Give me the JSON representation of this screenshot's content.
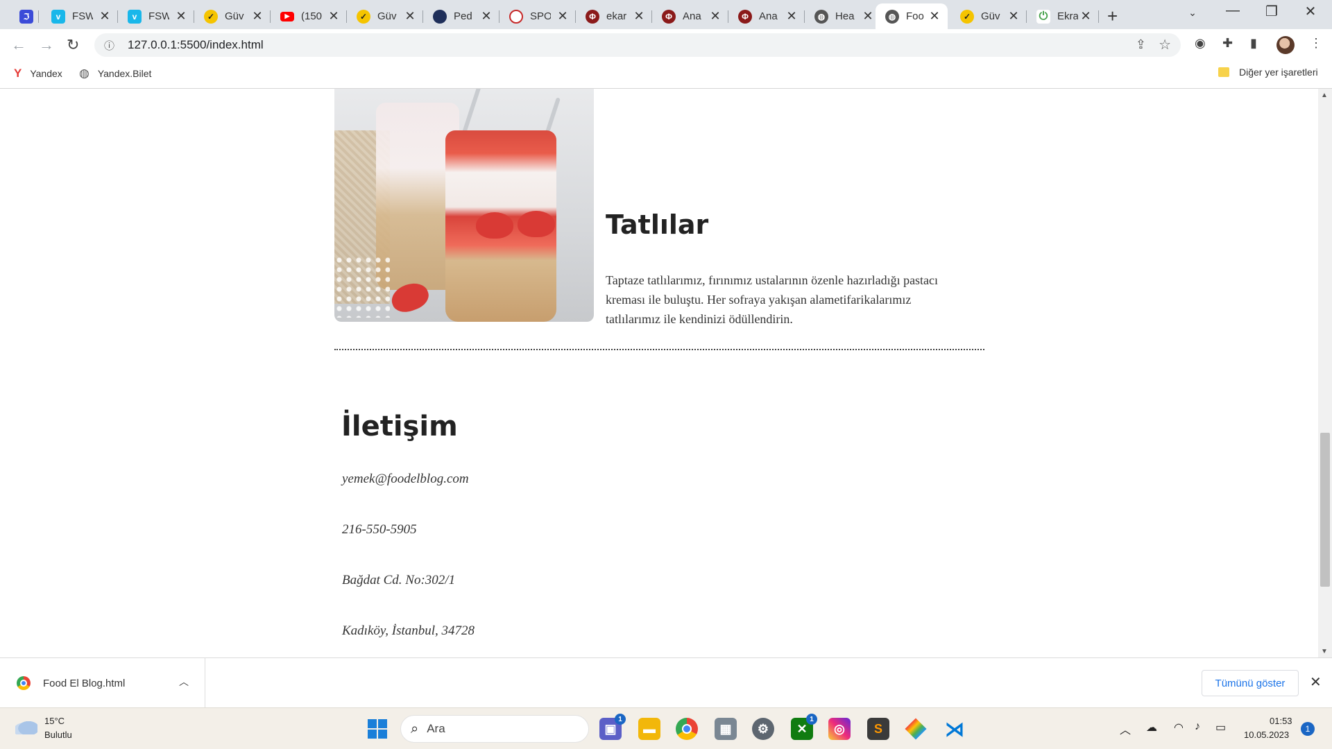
{
  "browser": {
    "tabs": [
      {
        "title": "",
        "icon": "vue-icon",
        "color": "#3b4bd8"
      },
      {
        "title": "FSW",
        "icon": "vimeo-icon",
        "color": "#19b7ea"
      },
      {
        "title": "FSW",
        "icon": "vimeo-icon",
        "color": "#19b7ea"
      },
      {
        "title": "Güv",
        "icon": "check-icon",
        "color": "#f5c400"
      },
      {
        "title": "(150",
        "icon": "youtube-icon",
        "color": "#ff0000"
      },
      {
        "title": "Güv",
        "icon": "check-icon",
        "color": "#f5c400"
      },
      {
        "title": "Ped",
        "icon": "seal-icon",
        "color": "#1f2f5a"
      },
      {
        "title": "SPO",
        "icon": "seal-icon",
        "color": "#c62828"
      },
      {
        "title": "ekar",
        "icon": "phi-icon",
        "color": "#8b1a1a"
      },
      {
        "title": "Ana",
        "icon": "phi-icon",
        "color": "#8b1a1a"
      },
      {
        "title": "Ana",
        "icon": "phi-icon",
        "color": "#8b1a1a"
      },
      {
        "title": "Hea",
        "icon": "globe-icon",
        "color": "#555555"
      },
      {
        "title": "Foo",
        "icon": "globe-icon",
        "color": "#555555",
        "active": true
      },
      {
        "title": "Güv",
        "icon": "check-icon",
        "color": "#f5c400"
      },
      {
        "title": "Ekra",
        "icon": "power-icon",
        "color": "#43a047"
      }
    ],
    "url": "127.0.0.1:5500/index.html",
    "bookmarks": [
      {
        "label": "Yandex",
        "icon": "yandex-icon"
      },
      {
        "label": "Yandex.Bilet",
        "icon": "globe-icon"
      }
    ],
    "other_bookmarks": "Diğer yer işaretleri"
  },
  "page": {
    "dessert": {
      "title": "Tatlılar",
      "description": "Taptaze tatlılarımız, fırınımız ustalarının özenle hazırladığı pastacı kreması ile buluştu. Her sofraya yakışan alametifarikalarımız tatlılarımız ile kendinizi ödüllendirin."
    },
    "contact": {
      "title": "İletişim",
      "email": "yemek@foodelblog.com",
      "phone": "216-550-5905",
      "address_line1": "Bağdat Cd. No:302/1",
      "address_line2": "Kadıköy, İstanbul, 34728"
    }
  },
  "download_bar": {
    "file_name": "Food El Blog.html",
    "show_all": "Tümünü göster"
  },
  "taskbar": {
    "temperature": "15°C",
    "weather": "Bulutlu",
    "search_placeholder": "Ara",
    "time": "01:53",
    "date": "10.05.2023",
    "notification_count": "1",
    "teams_badge": "1",
    "xbox_badge": "1"
  },
  "colors": {
    "accent": "#1a73e8",
    "tab_strip": "#dfe3e8",
    "taskbar": "#f3efe8"
  }
}
